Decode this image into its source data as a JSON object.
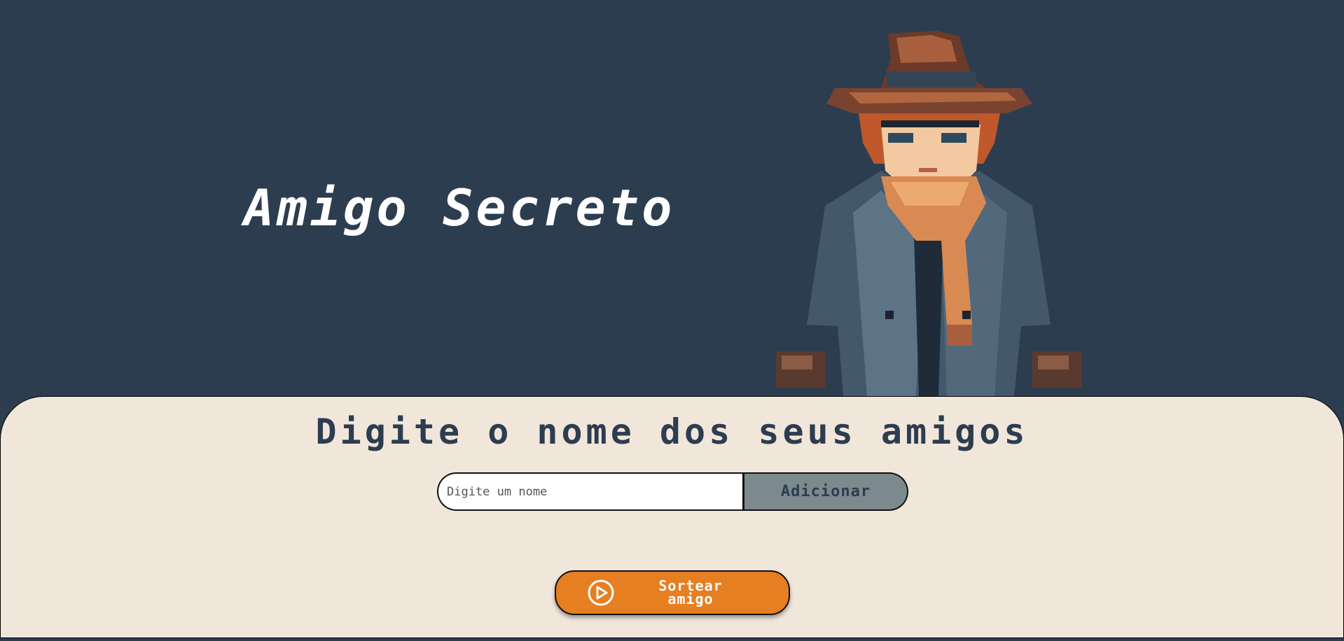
{
  "header": {
    "title": "Amigo Secreto",
    "illustration": "pixel-art-detective"
  },
  "main": {
    "heading": "Digite o nome dos seus amigos",
    "name_input": {
      "placeholder": "Digite um nome",
      "value": ""
    },
    "add_button_label": "Adicionar",
    "draw_button": {
      "label_line1": "Sortear",
      "label_line2": "amigo",
      "icon": "play-circle-icon"
    }
  },
  "colors": {
    "background": "#2c3d50",
    "panel": "#f1e6da",
    "accent": "#e67e22",
    "add_button": "#7d8a8d",
    "text_dark": "#2c3d50"
  }
}
